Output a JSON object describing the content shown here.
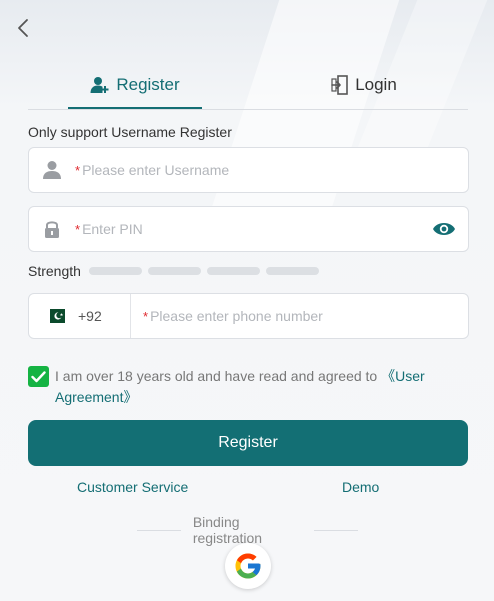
{
  "tabs": {
    "register": "Register",
    "login": "Login"
  },
  "hint": "Only support Username Register",
  "username": {
    "placeholder": "Please enter Username",
    "required_mark": "*"
  },
  "pin": {
    "placeholder": "Enter PIN",
    "required_mark": "*"
  },
  "strength": {
    "label": "Strength",
    "level": 0
  },
  "phone": {
    "country_code": "+92",
    "placeholder": "Please enter phone number",
    "required_mark": "*"
  },
  "agreement": {
    "checked": true,
    "text": "I am over 18 years old and have read and agreed to ",
    "link": "《User Agreement》"
  },
  "register_button": "Register",
  "links": {
    "customer_service": "Customer Service",
    "demo": "Demo"
  },
  "binding": "Binding registration",
  "colors": {
    "accent": "#136f74",
    "checkbox": "#15b343",
    "required": "#e0282e"
  },
  "icons": {
    "back": "chevron-left-icon",
    "register_tab": "user-add-icon",
    "login_tab": "login-door-icon",
    "username": "user-icon",
    "pin": "lock-icon",
    "visibility": "eye-icon",
    "country": "pakistan-flag-icon",
    "check": "check-icon",
    "social": "google-icon"
  }
}
